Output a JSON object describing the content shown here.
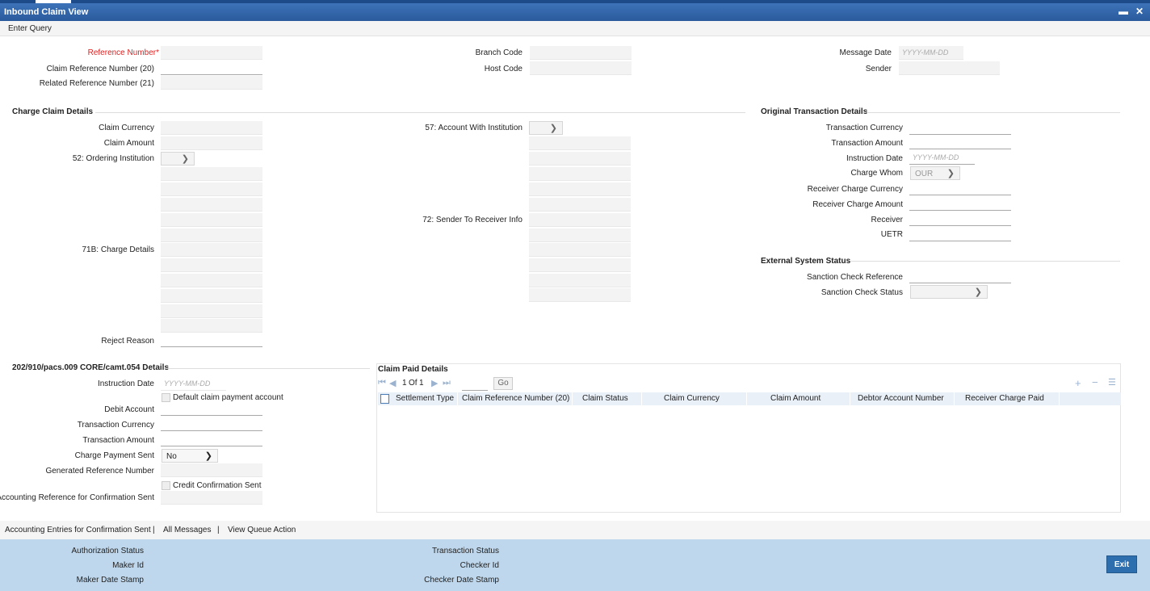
{
  "window": {
    "title": "Inbound Claim View",
    "minimize": "▬",
    "close": "✕"
  },
  "menu": {
    "enter_query": "Enter Query"
  },
  "header": {
    "reference_number": "Reference Number",
    "required_mark": "*",
    "claim_ref_20": "Claim Reference Number (20)",
    "related_ref_21": "Related Reference Number (21)",
    "branch_code": "Branch Code",
    "host_code": "Host Code",
    "message_date": "Message Date",
    "message_date_placeholder": "YYYY-MM-DD",
    "sender": "Sender"
  },
  "charge_claim": {
    "section": "Charge Claim Details",
    "claim_currency": "Claim Currency",
    "claim_amount": "Claim Amount",
    "ordering_institution": "52: Ordering Institution",
    "account_with_institution": "57: Account With Institution",
    "sender_to_receiver": "72: Sender To Receiver Info",
    "charge_details": "71B: Charge Details",
    "reject_reason": "Reject Reason"
  },
  "original_txn": {
    "section": "Original Transaction Details",
    "transaction_currency": "Transaction Currency",
    "transaction_amount": "Transaction Amount",
    "instruction_date": "Instruction Date",
    "instruction_date_placeholder": "YYYY-MM-DD",
    "charge_whom": "Charge Whom",
    "charge_whom_value": "OUR",
    "receiver_charge_currency": "Receiver Charge Currency",
    "receiver_charge_amount": "Receiver Charge Amount",
    "receiver": "Receiver",
    "uetr": "UETR"
  },
  "external_status": {
    "section": "External System Status",
    "sanction_check_reference": "Sanction Check Reference",
    "sanction_check_status": "Sanction Check Status"
  },
  "pacs": {
    "section": "202/910/pacs.009 CORE/camt.054 Details",
    "instruction_date": "Instruction Date",
    "instruction_date_placeholder": "YYYY-MM-DD",
    "default_claim_payment": "Default claim payment account",
    "debit_account": "Debit Account",
    "transaction_currency": "Transaction Currency",
    "transaction_amount": "Transaction Amount",
    "charge_payment_sent": "Charge Payment Sent",
    "charge_payment_sent_value": "No",
    "generated_reference": "Generated Reference Number",
    "credit_confirmation_sent": "Credit Confirmation Sent",
    "accounting_reference": "Accounting Reference for Confirmation Sent"
  },
  "claim_paid": {
    "section": "Claim Paid Details",
    "page": "1",
    "of_label": "Of",
    "total_pages": "1",
    "go": "Go",
    "columns": [
      "Settlement Type",
      "Claim Reference Number (20)",
      "Claim Status",
      "Claim Currency",
      "Claim Amount",
      "Debtor Account Number",
      "Receiver Charge Paid"
    ]
  },
  "links": {
    "accounting_entries": "Accounting Entries for Confirmation Sent",
    "sep1": "|",
    "all_messages": "All Messages",
    "sep2": "|",
    "view_queue": "View Queue Action"
  },
  "footer": {
    "authorization_status": "Authorization Status",
    "maker_id": "Maker Id",
    "maker_date_stamp": "Maker Date Stamp",
    "transaction_status": "Transaction Status",
    "checker_id": "Checker Id",
    "checker_date_stamp": "Checker Date Stamp",
    "exit": "Exit"
  },
  "colors": {
    "titlebar": "#2a5a9c",
    "required": "#d22",
    "footer": "#bed7ec",
    "exit_button": "#2d6fae"
  }
}
